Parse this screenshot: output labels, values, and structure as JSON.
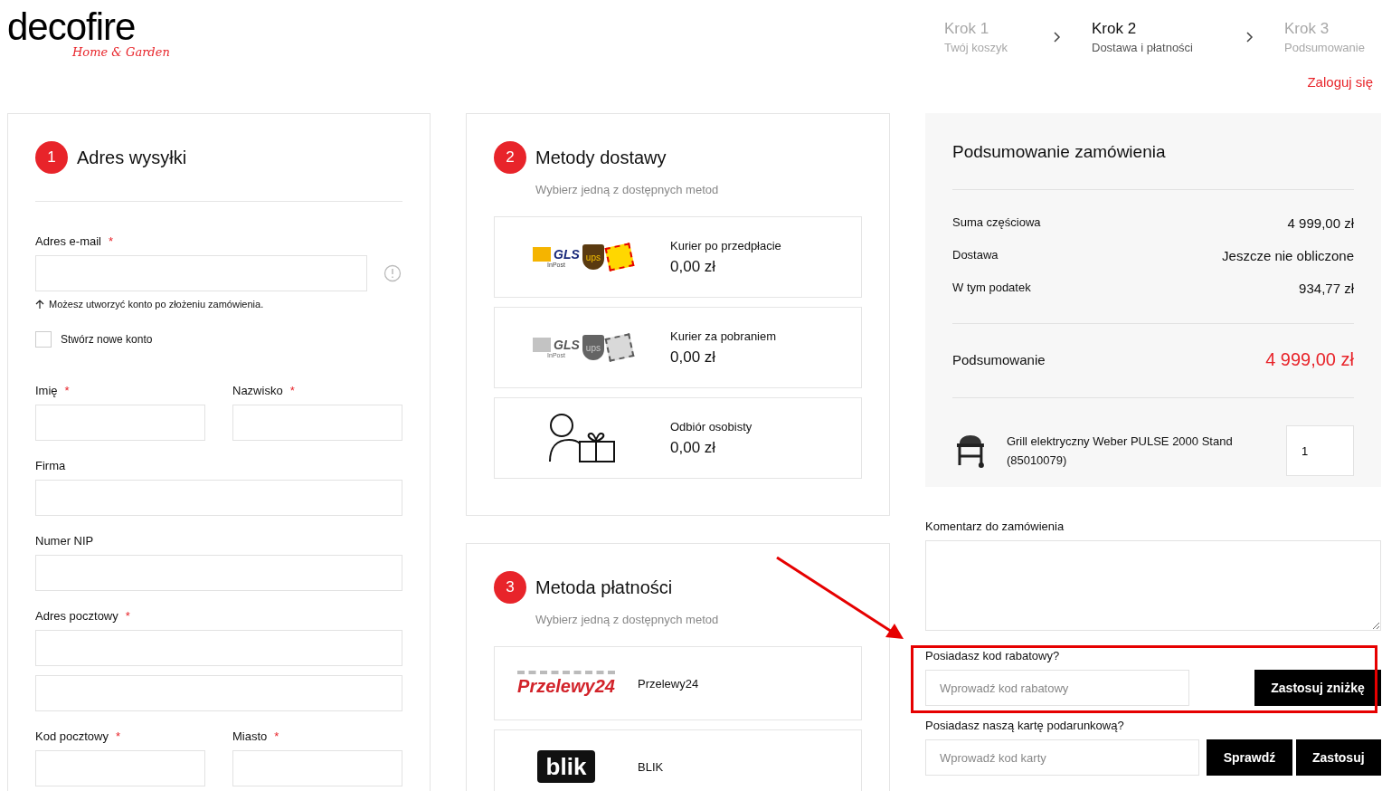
{
  "logo": {
    "brand": "decofire",
    "tagline": "Home & Garden"
  },
  "steps": [
    {
      "title": "Krok 1",
      "subtitle": "Twój koszyk",
      "selected": false
    },
    {
      "title": "Krok 2",
      "subtitle": "Dostawa i płatności",
      "selected": true
    },
    {
      "title": "Krok 3",
      "subtitle": "Podsumowanie",
      "selected": false
    }
  ],
  "login_link": "Zaloguj się",
  "address": {
    "step": "1",
    "title": "Adres wysyłki",
    "email": {
      "label": "Adres e-mail",
      "mark": "*"
    },
    "hint": "Możesz utworzyć konto po złożeniu zamówienia.",
    "create_account": {
      "label": "Stwórz nowe konto",
      "checked": false
    },
    "rows": [
      [
        {
          "label": "Imię",
          "mark": "*"
        },
        {
          "label": "Nazwisko",
          "mark": "*"
        }
      ],
      [
        {
          "label": "Firma"
        }
      ],
      [
        {
          "label": "Numer NIP"
        }
      ],
      [
        {
          "label": "Adres pocztowy",
          "mark": "*",
          "second_line": true
        }
      ],
      [
        {
          "label": "Kod pocztowy",
          "mark": "*"
        },
        {
          "label": "Miasto",
          "mark": "*"
        }
      ]
    ]
  },
  "delivery": {
    "step": "2",
    "title": "Metody dostawy",
    "subtitle": "Wybierz jedną z dostępnych metod",
    "options": [
      {
        "kind": "carriers",
        "logos": [
          "GLS",
          "InPost",
          "ups"
        ],
        "name": "Kurier po przedpłacie",
        "price": "0,00 zł",
        "muted": false
      },
      {
        "kind": "carriers",
        "logos": [
          "GLS",
          "InPost",
          "ups"
        ],
        "name": "Kurier za pobraniem",
        "price": "0,00 zł",
        "muted": true
      },
      {
        "kind": "pickup",
        "name": "Odbiór osobisty",
        "price": "0,00 zł"
      }
    ]
  },
  "payment": {
    "step": "3",
    "title": "Metoda płatności",
    "subtitle": "Wybierz jedną z dostępnych metod",
    "options": [
      {
        "kind": "p24",
        "logo": "Przelewy24",
        "name": "Przelewy24"
      },
      {
        "kind": "blik",
        "logo": "blik",
        "name": "BLIK"
      }
    ]
  },
  "summary": {
    "title": "Podsumowanie zamówienia",
    "rows": [
      {
        "label": "Suma częściowa",
        "value": "4 999,00 zł"
      },
      {
        "label": "Dostawa",
        "value": "Jeszcze nie obliczone"
      },
      {
        "label": "W tym podatek",
        "value": "934,77 zł"
      }
    ],
    "total_label": "Podsumowanie",
    "total_value": "4 999,00 zł",
    "product": {
      "name": "Grill elektryczny Weber PULSE 2000 Stand (85010079)",
      "quantity": "1"
    }
  },
  "comment": {
    "label": "Komentarz do zamówienia"
  },
  "discount": {
    "label": "Posiadasz kod rabatowy?",
    "placeholder": "Wprowadź kod rabatowy",
    "button": "Zastosuj zniżkę",
    "highlighted": true
  },
  "gift_card": {
    "label": "Posiadasz naszą kartę podarunkową?",
    "placeholder": "Wprowadź kod karty",
    "buttons": [
      "Sprawdź",
      "Zastosuj"
    ]
  }
}
